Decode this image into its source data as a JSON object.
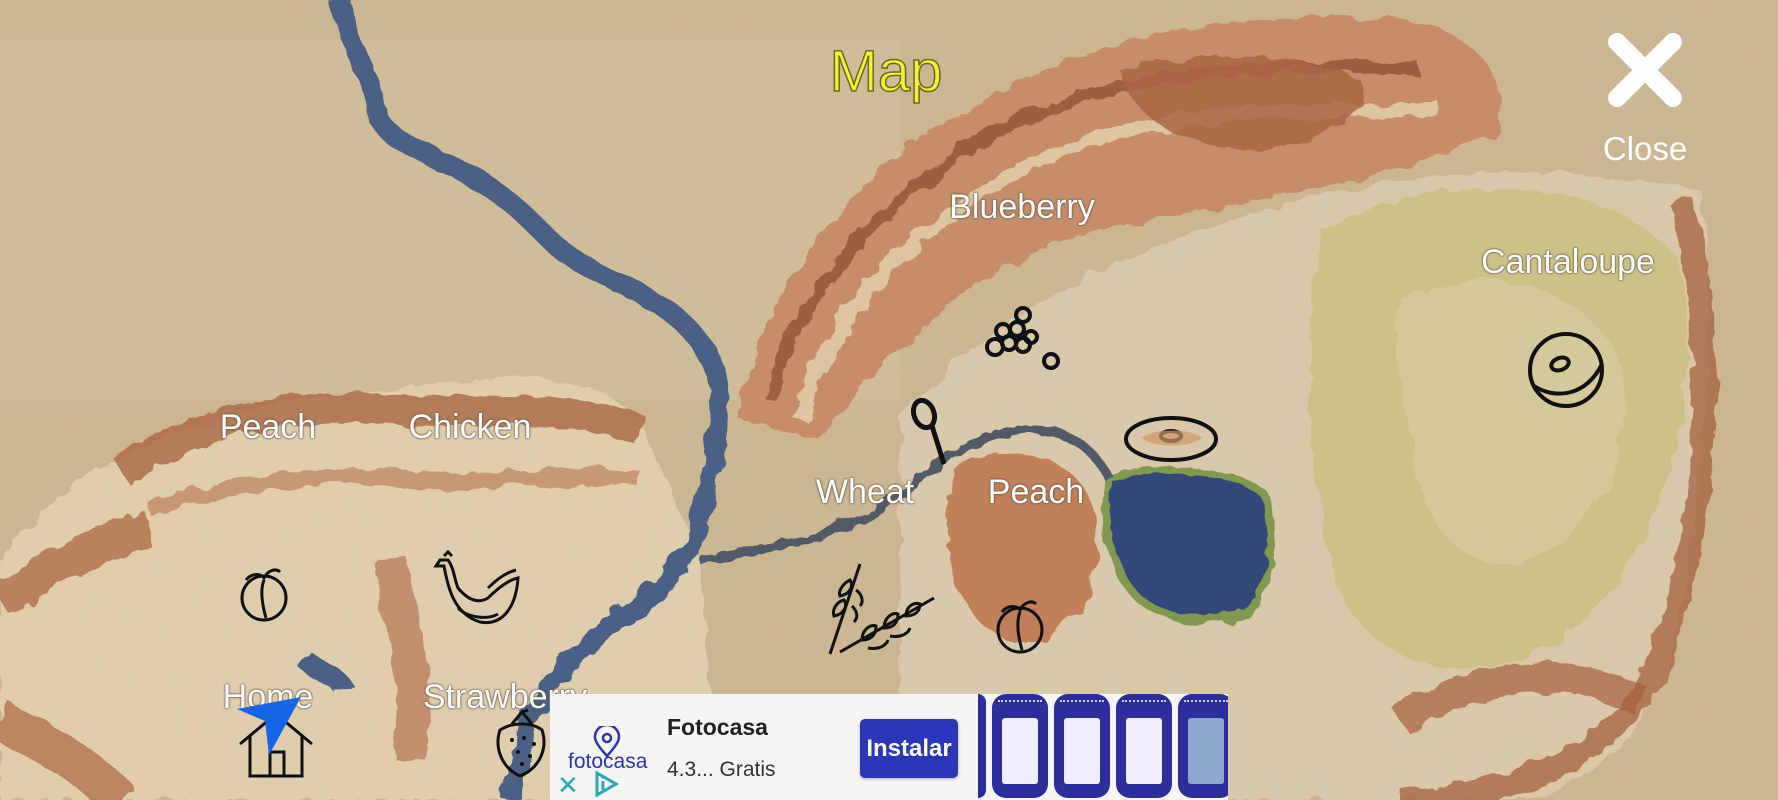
{
  "header": {
    "title": "Map"
  },
  "close": {
    "icon": "close-x-icon",
    "label": "Close"
  },
  "map": {
    "locations": [
      {
        "id": "peach-west",
        "label": "Peach",
        "icon": "peach-icon"
      },
      {
        "id": "chicken",
        "label": "Chicken",
        "icon": "chicken-icon"
      },
      {
        "id": "home",
        "label": "Home",
        "icon": "house-icon"
      },
      {
        "id": "strawberry",
        "label": "Strawberry",
        "icon": "strawberry-icon"
      },
      {
        "id": "wheat",
        "label": "Wheat",
        "icon": "wheat-icon"
      },
      {
        "id": "peach-center",
        "label": "Peach",
        "icon": "peach-icon"
      },
      {
        "id": "blueberry",
        "label": "Blueberry",
        "icon": "blueberry-icon"
      },
      {
        "id": "cantaloupe",
        "label": "Cantaloupe",
        "icon": "cantaloupe-icon"
      }
    ],
    "extra_icons": [
      "magnifier-icon",
      "donut-icon"
    ],
    "player_marker": "player-arrow-icon"
  },
  "ad": {
    "app_name": "Fotocasa",
    "logo_text": "fotocasa",
    "meta": "4.3... Gratis",
    "install_label": "Instalar",
    "close_icon": "close-ad-icon",
    "adchoices_icon": "adchoices-icon",
    "colors": {
      "brand": "#2a37b8",
      "accent": "#29a8b8"
    }
  }
}
